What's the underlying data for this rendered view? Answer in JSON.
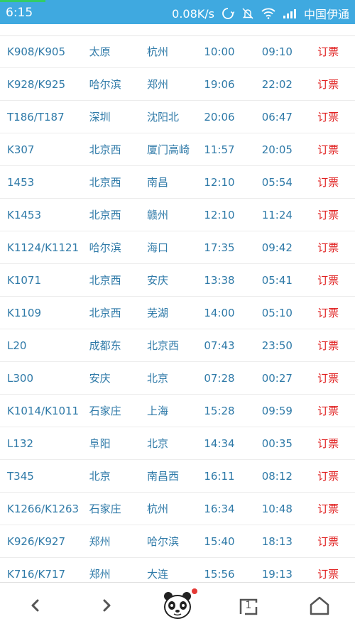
{
  "status": {
    "time": "6:15",
    "speed": "0.08K/s",
    "carrier": "中国伊通"
  },
  "trains": [
    {
      "number": "K908/K905",
      "from": "太原",
      "to": "杭州",
      "depart": "10:00",
      "arrive": "09:10",
      "action": "订票"
    },
    {
      "number": "K928/K925",
      "from": "哈尔滨",
      "to": "郑州",
      "depart": "19:06",
      "arrive": "22:02",
      "action": "订票"
    },
    {
      "number": "T186/T187",
      "from": "深圳",
      "to": "沈阳北",
      "depart": "20:06",
      "arrive": "06:47",
      "action": "订票"
    },
    {
      "number": "K307",
      "from": "北京西",
      "to": "厦门高崎",
      "depart": "11:57",
      "arrive": "20:05",
      "action": "订票"
    },
    {
      "number": "1453",
      "from": "北京西",
      "to": "南昌",
      "depart": "12:10",
      "arrive": "05:54",
      "action": "订票"
    },
    {
      "number": "K1453",
      "from": "北京西",
      "to": "赣州",
      "depart": "12:10",
      "arrive": "11:24",
      "action": "订票"
    },
    {
      "number": "K1124/K1121",
      "from": "哈尔滨",
      "to": "海口",
      "depart": "17:35",
      "arrive": "09:42",
      "action": "订票"
    },
    {
      "number": "K1071",
      "from": "北京西",
      "to": "安庆",
      "depart": "13:38",
      "arrive": "05:41",
      "action": "订票"
    },
    {
      "number": "K1109",
      "from": "北京西",
      "to": "芜湖",
      "depart": "14:00",
      "arrive": "05:10",
      "action": "订票"
    },
    {
      "number": "L20",
      "from": "成都东",
      "to": "北京西",
      "depart": "07:43",
      "arrive": "23:50",
      "action": "订票"
    },
    {
      "number": "L300",
      "from": "安庆",
      "to": "北京",
      "depart": "07:28",
      "arrive": "00:27",
      "action": "订票"
    },
    {
      "number": "K1014/K1011",
      "from": "石家庄",
      "to": "上海",
      "depart": "15:28",
      "arrive": "09:59",
      "action": "订票"
    },
    {
      "number": "L132",
      "from": "阜阳",
      "to": "北京",
      "depart": "14:34",
      "arrive": "00:35",
      "action": "订票"
    },
    {
      "number": "T345",
      "from": "北京",
      "to": "南昌西",
      "depart": "16:11",
      "arrive": "08:12",
      "action": "订票"
    },
    {
      "number": "K1266/K1263",
      "from": "石家庄",
      "to": "杭州",
      "depart": "16:34",
      "arrive": "10:48",
      "action": "订票"
    },
    {
      "number": "K926/K927",
      "from": "郑州",
      "to": "哈尔滨",
      "depart": "15:40",
      "arrive": "18:13",
      "action": "订票"
    },
    {
      "number": "K716/K717",
      "from": "郑州",
      "to": "大连",
      "depart": "15:56",
      "arrive": "19:13",
      "action": "订票"
    }
  ],
  "nav": {
    "tab_badge": "1",
    "icons": [
      "back-icon",
      "forward-icon",
      "panda-icon",
      "tabs-icon",
      "home-icon"
    ]
  },
  "colors": {
    "statusbar": "#3fa9e0",
    "row_text": "#2f7aa8",
    "book_text": "#e02020"
  }
}
